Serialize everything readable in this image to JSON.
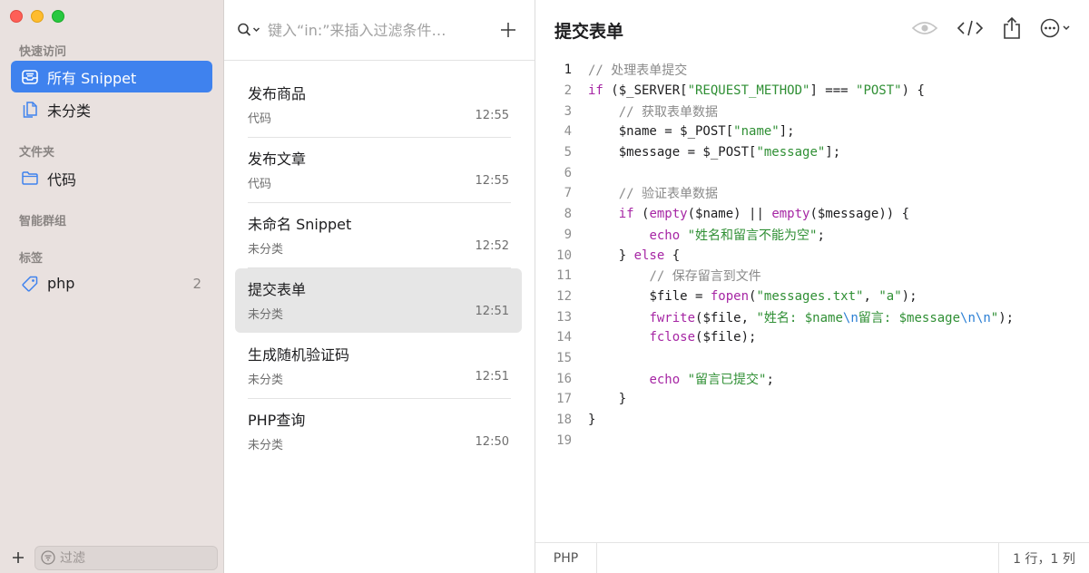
{
  "window": {
    "traffic_lights": {
      "close": "#fe5f57",
      "minimize": "#febc2e",
      "zoom": "#28c840"
    }
  },
  "sidebar": {
    "sections": {
      "quick_access": "快速访问",
      "folders": "文件夹",
      "smart_groups": "智能群组",
      "tags": "标签"
    },
    "quick_items": [
      {
        "label": "所有 Snippet",
        "icon": "tray-icon",
        "active": true
      },
      {
        "label": "未分类",
        "icon": "documents-icon",
        "active": false
      }
    ],
    "folder_items": [
      {
        "label": "代码",
        "icon": "folder-icon"
      }
    ],
    "tag_items": [
      {
        "label": "php",
        "icon": "tag-icon",
        "count": "2"
      }
    ],
    "filter_placeholder": "过滤",
    "accent": "#3f82ee"
  },
  "list": {
    "search_placeholder": "键入“in:”来插入过滤条件…",
    "snippets": [
      {
        "title": "发布商品",
        "folder": "代码",
        "time": "12:55",
        "selected": false
      },
      {
        "title": "发布文章",
        "folder": "代码",
        "time": "12:55",
        "selected": false
      },
      {
        "title": "未命名 Snippet",
        "folder": "未分类",
        "time": "12:52",
        "selected": false
      },
      {
        "title": "提交表单",
        "folder": "未分类",
        "time": "12:51",
        "selected": true
      },
      {
        "title": "生成随机验证码",
        "folder": "未分类",
        "time": "12:51",
        "selected": false
      },
      {
        "title": "PHP查询",
        "folder": "未分类",
        "time": "12:50",
        "selected": false
      }
    ]
  },
  "editor": {
    "title": "提交表单",
    "toolbar_icons": [
      "eye-icon",
      "code-icon",
      "share-icon",
      "more-icon"
    ],
    "code_lines": [
      "1",
      "2",
      "3",
      "4",
      "5",
      "6",
      "7",
      "8",
      "9",
      "10",
      "11",
      "12",
      "13",
      "14",
      "15",
      "16",
      "17",
      "18",
      "19"
    ],
    "code": {
      "l1_comment": "// 处理表单提交",
      "l2_if": "if",
      "l2_a": " ($_SERVER[",
      "l2_str": "\"REQUEST_METHOD\"",
      "l2_b": "] === ",
      "l2_str2": "\"POST\"",
      "l2_c": ") {",
      "l3_comment": "// 获取表单数据",
      "l4_a": "$name = $_POST[",
      "l4_str": "\"name\"",
      "l4_b": "];",
      "l5_a": "$message = $_POST[",
      "l5_str": "\"message\"",
      "l5_b": "];",
      "l7_comment": "// 验证表单数据",
      "l8_if": "if",
      "l8_a": " (",
      "l8_f1": "empty",
      "l8_b": "($name) || ",
      "l8_f2": "empty",
      "l8_c": "($message)) {",
      "l9_echo": "echo",
      "l9_str": " \"姓名和留言不能为空\"",
      "l9_end": ";",
      "l10_a": "} ",
      "l10_else": "else",
      "l10_b": " {",
      "l11_comment": "// 保存留言到文件",
      "l12_a": "$file = ",
      "l12_f": "fopen",
      "l12_b": "(",
      "l12_s1": "\"messages.txt\"",
      "l12_c": ", ",
      "l12_s2": "\"a\"",
      "l12_d": ");",
      "l13_f": "fwrite",
      "l13_a": "($file, ",
      "l13_s1": "\"姓名: $name",
      "l13_e1": "\\n",
      "l13_s2": "留言: $message",
      "l13_e2": "\\n\\n",
      "l13_s3": "\"",
      "l13_b": ");",
      "l14_f": "fclose",
      "l14_a": "($file);",
      "l16_echo": "echo",
      "l16_str": " \"留言已提交\"",
      "l16_end": ";",
      "l17": "}",
      "l18": "}"
    }
  },
  "statusbar": {
    "language": "PHP",
    "position": "1 行，1 列"
  }
}
